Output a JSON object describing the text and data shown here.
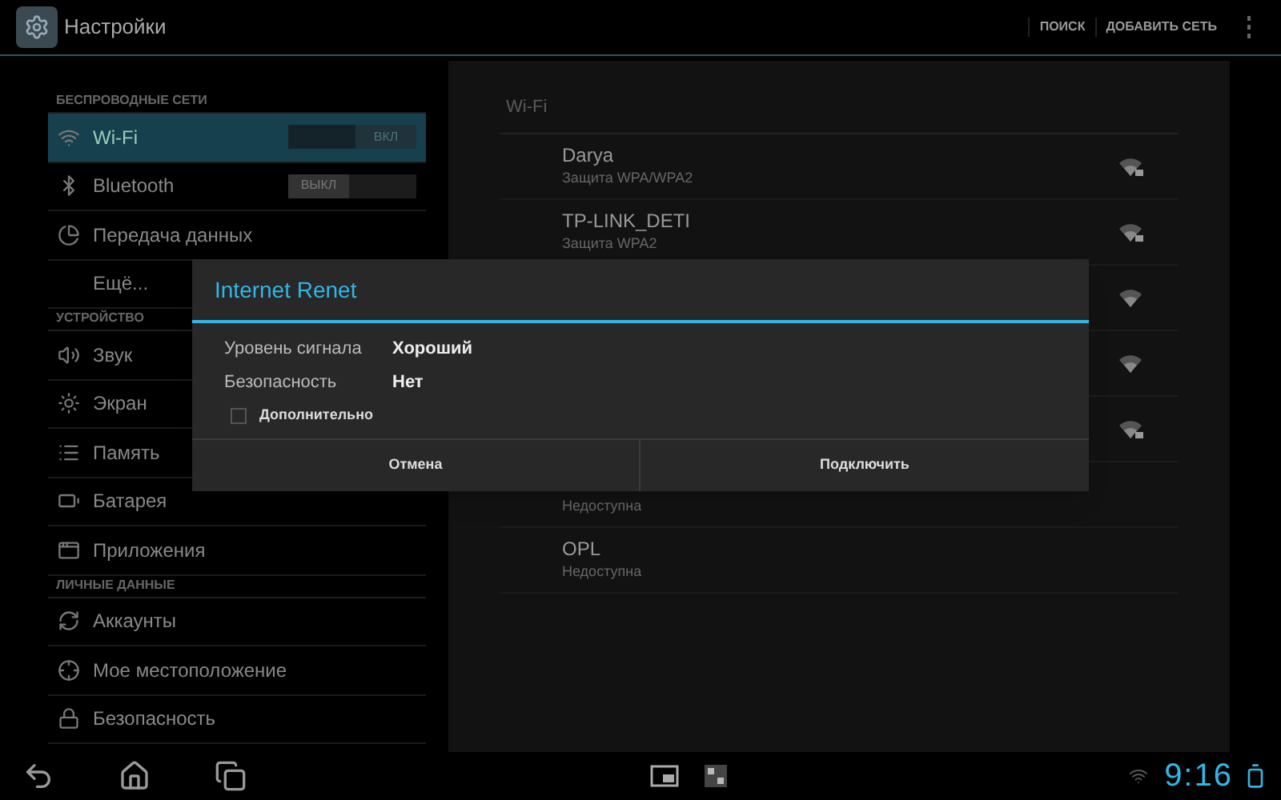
{
  "action_bar": {
    "title": "Настройки",
    "actions": [
      "ПОИСК",
      "ДОБАВИТЬ СЕТЬ"
    ]
  },
  "sidebar": {
    "sections": [
      {
        "header": "БЕСПРОВОДНЫЕ СЕТИ",
        "items": [
          {
            "label": "Wi-Fi",
            "selected": true,
            "toggle": {
              "on": true,
              "label": "ВКЛ"
            }
          },
          {
            "label": "Bluetooth",
            "selected": false,
            "toggle": {
              "on": false,
              "label": "ВЫКЛ"
            }
          },
          {
            "label": "Передача данных",
            "selected": false
          },
          {
            "label": "Ещё...",
            "selected": false
          }
        ]
      },
      {
        "header": "УСТРОЙСТВО",
        "items": [
          {
            "label": "Звук",
            "selected": false
          },
          {
            "label": "Экран",
            "selected": false
          },
          {
            "label": "Память",
            "selected": false
          },
          {
            "label": "Батарея",
            "selected": false
          },
          {
            "label": "Приложения",
            "selected": false
          }
        ]
      },
      {
        "header": "ЛИЧНЫЕ ДАННЫЕ",
        "items": [
          {
            "label": "Аккаунты",
            "selected": false
          },
          {
            "label": "Мое местоположение",
            "selected": false
          },
          {
            "label": "Безопасность",
            "selected": false
          }
        ]
      }
    ]
  },
  "wifi_panel": {
    "header": "Wi-Fi",
    "networks": [
      {
        "name": "Darya",
        "status": "Защита WPA/WPA2",
        "kind": "secured"
      },
      {
        "name": "TP-LINK_DETI",
        "status": "Защита WPA2",
        "kind": "secured"
      },
      {
        "kind": "open"
      },
      {
        "kind": "open"
      },
      {
        "kind": "secured"
      },
      {
        "status": "Недоступна",
        "kind": "unavailable"
      },
      {
        "name": "OPL",
        "status": "Недоступна",
        "kind": "unavailable"
      }
    ]
  },
  "dialog": {
    "title": "Internet Renet",
    "fields": [
      {
        "label": "Уровень сигнала",
        "value": "Хороший"
      },
      {
        "label": "Безопасность",
        "value": "Нет"
      }
    ],
    "advanced": {
      "label": "Дополнительно",
      "checked": false
    },
    "buttons": [
      "Отмена",
      "Подключить"
    ]
  },
  "status_bar": {
    "time": "9:16"
  }
}
